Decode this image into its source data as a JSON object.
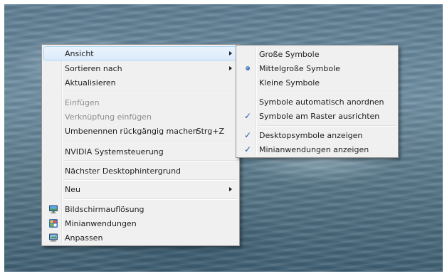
{
  "context_menu": {
    "items": [
      {
        "label": "Ansicht",
        "highlighted": true,
        "has_submenu": true
      },
      {
        "label": "Sortieren nach",
        "has_submenu": true
      },
      {
        "label": "Aktualisieren"
      },
      {
        "label": "Einfügen",
        "disabled": true
      },
      {
        "label": "Verknüpfung einfügen",
        "disabled": true
      },
      {
        "label": "Umbenennen rückgängig machen",
        "shortcut": "Strg+Z"
      },
      {
        "label": "NVIDIA Systemsteuerung"
      },
      {
        "label": "Nächster Desktophintergrund"
      },
      {
        "label": "Neu",
        "has_submenu": true
      },
      {
        "label": "Bildschirmauflösung",
        "icon": "display-resolution-icon"
      },
      {
        "label": "Minianwendungen",
        "icon": "gadgets-icon"
      },
      {
        "label": "Anpassen",
        "icon": "personalize-icon"
      }
    ]
  },
  "view_submenu": {
    "items": [
      {
        "label": "Große Symbole"
      },
      {
        "label": "Mittelgroße Symbole",
        "selected": true,
        "mark": "radio-bullet"
      },
      {
        "label": "Kleine Symbole"
      },
      {
        "label": "Symbole automatisch anordnen"
      },
      {
        "label": "Symbole am Raster ausrichten",
        "checked": true
      },
      {
        "label": "Desktopsymbole anzeigen",
        "checked": true
      },
      {
        "label": "Minianwendungen anzeigen",
        "checked": true
      }
    ]
  },
  "colors": {
    "menu_background": "#f0f0f0",
    "menu_border": "#979797",
    "highlight_background": "#dcebfc",
    "highlight_border": "#a8d8f6",
    "disabled_text": "#8d8d8d",
    "check_color": "#1c5da8"
  },
  "glyphs": {
    "check": "✓"
  }
}
